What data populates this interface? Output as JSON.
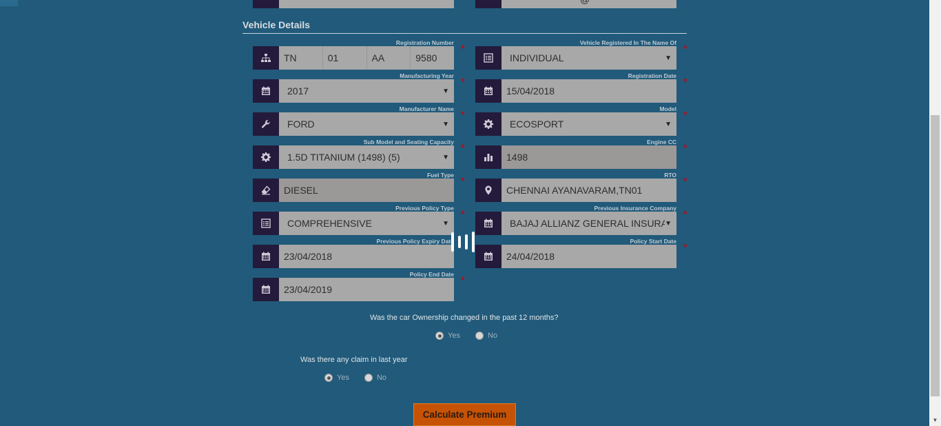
{
  "section": {
    "title": "Vehicle Details"
  },
  "top_partial": {
    "right_value": "@"
  },
  "registration": {
    "label": "Registration Number",
    "parts": [
      "TN",
      "01",
      "AA",
      "9580"
    ],
    "icon": "sitemap-icon"
  },
  "fields": {
    "registered_name": {
      "label": "Vehicle Registered In The Name Of",
      "value": "INDIVIDUAL",
      "icon": "list-icon"
    },
    "manufacturing_year": {
      "label": "Manufacturing Year",
      "value": "2017",
      "icon": "calendar-icon"
    },
    "registration_date": {
      "label": "Registration Date",
      "value": "15/04/2018",
      "icon": "calendar-icon"
    },
    "manufacturer_name": {
      "label": "Manufacturer Name",
      "value": "FORD",
      "icon": "wrench-icon"
    },
    "model": {
      "label": "Model",
      "value": "ECOSPORT",
      "icon": "gear-icon"
    },
    "sub_model": {
      "label": "Sub Model and Seating Capacity",
      "value": "1.5D TITANIUM (1498) (5)",
      "icon": "gear-icon"
    },
    "engine_cc": {
      "label": "Engine CC",
      "value": "1498",
      "icon": "bar-chart-icon"
    },
    "fuel_type": {
      "label": "Fuel Type",
      "value": "DIESEL",
      "icon": "eraser-icon"
    },
    "rto": {
      "label": "RTO",
      "value": "CHENNAI AYANAVARAM,TN01",
      "icon": "map-marker-icon"
    },
    "prev_policy_type": {
      "label": "Previous Policy Type",
      "value": "COMPREHENSIVE",
      "icon": "list-icon"
    },
    "prev_insurance_company": {
      "label": "Previous Insurance Company",
      "value": "BAJAJ ALLIANZ GENERAL INSURAN",
      "icon": "calendar-icon"
    },
    "prev_policy_expiry": {
      "label": "Previous Policy Expiry Date",
      "value": "23/04/2018",
      "icon": "calendar-icon"
    },
    "policy_start": {
      "label": "Policy Start Date",
      "value": "24/04/2018",
      "icon": "calendar-icon"
    },
    "policy_end": {
      "label": "Policy End Date",
      "value": "23/04/2019",
      "icon": "calendar-icon"
    }
  },
  "required_mark": "*",
  "questions": {
    "ownership": {
      "text": "Was the car Ownership changed in the past 12 months?",
      "yes": "Yes",
      "no": "No",
      "selected": "Yes"
    },
    "claim": {
      "text": "Was there any claim in last year",
      "yes": "Yes",
      "no": "No",
      "selected": "Yes"
    }
  },
  "buttons": {
    "calculate": "Calculate Premium"
  },
  "colors": {
    "background": "#215a7a",
    "icon_bg": "#241a3b",
    "field_bg": "#a8a8a8",
    "button": "#c65305",
    "required": "#b40f1e"
  }
}
